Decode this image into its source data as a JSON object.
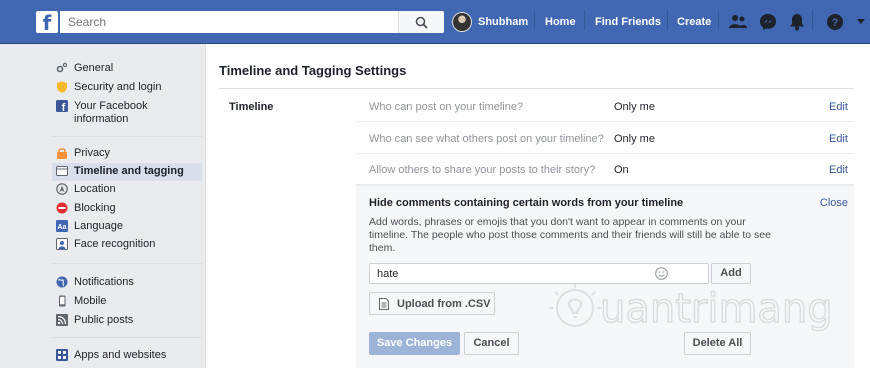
{
  "header": {
    "logo": "f",
    "search_placeholder": "Search",
    "profile_name": "Shubham",
    "nav": [
      "Home",
      "Find Friends",
      "Create"
    ],
    "icons": [
      "friend-requests-icon",
      "messenger-icon",
      "notifications-icon",
      "help-icon",
      "dropdown-icon"
    ]
  },
  "sidebar": {
    "groups": [
      [
        {
          "label": "General",
          "icon": "gear-icon"
        },
        {
          "label": "Security and login",
          "icon": "shield-icon"
        },
        {
          "label": "Your Facebook information",
          "icon": "facebook-icon"
        }
      ],
      [
        {
          "label": "Privacy",
          "icon": "lock-icon"
        },
        {
          "label": "Timeline and tagging",
          "icon": "timeline-icon",
          "active": true
        },
        {
          "label": "Location",
          "icon": "location-icon"
        },
        {
          "label": "Blocking",
          "icon": "block-icon"
        },
        {
          "label": "Language",
          "icon": "language-icon"
        },
        {
          "label": "Face recognition",
          "icon": "face-icon"
        }
      ],
      [
        {
          "label": "Notifications",
          "icon": "globe-icon"
        },
        {
          "label": "Mobile",
          "icon": "mobile-icon"
        },
        {
          "label": "Public posts",
          "icon": "rss-icon"
        }
      ],
      [
        {
          "label": "Apps and websites",
          "icon": "apps-icon"
        }
      ]
    ]
  },
  "main": {
    "title": "Timeline and Tagging Settings",
    "section_label": "Timeline",
    "rows": [
      {
        "question": "Who can post on your timeline?",
        "value": "Only me",
        "action": "Edit"
      },
      {
        "question": "Who can see what others post on your timeline?",
        "value": "Only me",
        "action": "Edit"
      },
      {
        "question": "Allow others to share your posts to their story?",
        "value": "On",
        "action": "Edit"
      }
    ],
    "panel": {
      "title": "Hide comments containing certain words from your timeline",
      "close_label": "Close",
      "description": "Add words, phrases or emojis that you don't want to appear in comments on your timeline. The people who post those comments and their friends will still be able to see them.",
      "input_value": "hate",
      "add_label": "Add",
      "upload_label": "Upload from .CSV",
      "save_label": "Save Changes",
      "cancel_label": "Cancel",
      "delete_all_label": "Delete All"
    }
  },
  "watermark": "Quantrimang",
  "colors": {
    "brand": "#4267b2",
    "link": "#365899",
    "save_disabled": "#9cb4d8",
    "active_nav": "#d8dfea"
  }
}
